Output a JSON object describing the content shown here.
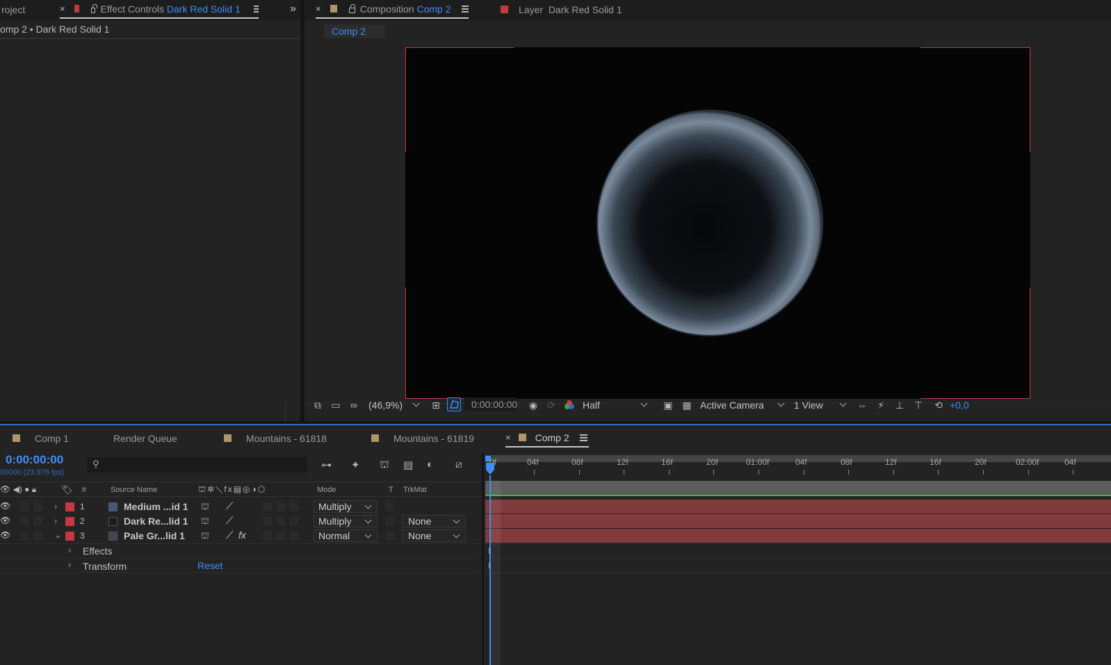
{
  "top_tabs": {
    "project": "roject",
    "effect_controls_prefix": "Effect Controls",
    "effect_controls_layer": "Dark Red Solid 1",
    "composition_prefix": "Composition",
    "composition_name": "Comp 2",
    "layer_prefix": "Layer",
    "layer_name": "Dark Red Solid 1"
  },
  "effect_controls": {
    "breadcrumb": "omp 2 • Dark Red Solid 1"
  },
  "viewer": {
    "comp_tab": "Comp 2",
    "zoom": "(46,9%)",
    "timecode": "0:00:00:00",
    "resolution": "Half",
    "camera": "Active Camera",
    "views": "1 View",
    "exposure": "+0,0"
  },
  "bottom_tabs": [
    "Comp 1",
    "Render Queue",
    "Mountains - 61818",
    "Mountains - 61819",
    "Comp 2"
  ],
  "timeline": {
    "timecode": "0:00:00:00",
    "fps": "00000 (23.976 fps)",
    "headers": {
      "num": "#",
      "source": "Source Name",
      "mode": "Mode",
      "t": "T",
      "trkmat": "TrkMat"
    },
    "ruler": [
      "0f",
      "04f",
      "08f",
      "12f",
      "16f",
      "20f",
      "01:00f",
      "04f",
      "08f",
      "12f",
      "16f",
      "20f",
      "02:00f",
      "04f"
    ],
    "layers": [
      {
        "num": "1",
        "name": "Medium ...id 1",
        "color": "#3e5a7e",
        "mode": "Multiply",
        "trkmat": ""
      },
      {
        "num": "2",
        "name": "Dark Re...lid 1",
        "color": "#1c1c1c",
        "mode": "Multiply",
        "trkmat": "None"
      },
      {
        "num": "3",
        "name": "Pale Gr...lid 1",
        "color": "#3b4656",
        "mode": "Normal",
        "trkmat": "None"
      }
    ],
    "sub": {
      "effects": "Effects",
      "transform": "Transform",
      "reset": "Reset"
    }
  },
  "colors": {
    "accent": "#3d8ff5",
    "label_red": "#c3393d",
    "track_red": "#823b3d",
    "label_tan": "#b0946a"
  }
}
